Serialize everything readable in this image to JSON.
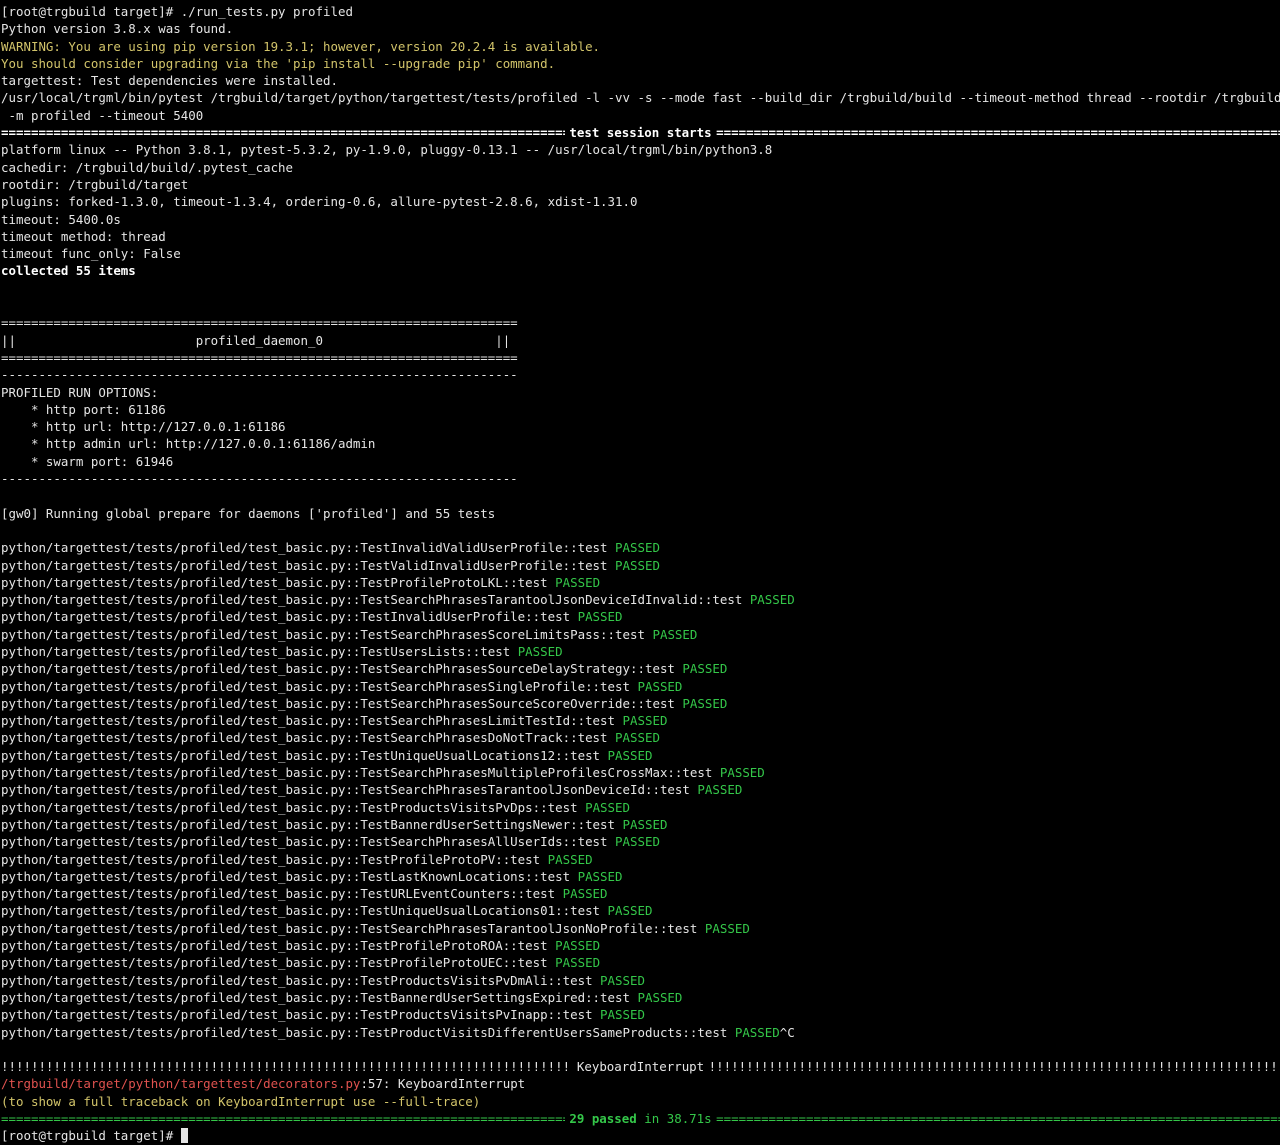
{
  "colors": {
    "background": "#000000",
    "text": "#e5e5e5",
    "warning": "#d2c46a",
    "passed": "#34c749",
    "error": "#e0524f"
  },
  "icons": {
    "cursor": "block-cursor-icon"
  },
  "header": {
    "command": "[root@trgbuild target]# ./run_tests.py profiled",
    "python_found": "Python version 3.8.x was found.",
    "warn1": "WARNING: You are using pip version 19.3.1; however, version 20.2.4 is available.",
    "warn2": "You should consider upgrading via the 'pip install --upgrade pip' command.",
    "deps": "targettest: Test dependencies were installed.",
    "pytest_cmd1": "/usr/local/trgml/bin/pytest /trgbuild/target/python/targettest/tests/profiled -l -vv -s --mode fast --build_dir /trgbuild/build --timeout-method thread --rootdir /trgbuild/target -",
    "pytest_cmd2": " -m profiled --timeout 5400"
  },
  "session": {
    "start_title": "test session starts",
    "platform": "platform linux -- Python 3.8.1, pytest-5.3.2, py-1.9.0, pluggy-0.13.1 -- /usr/local/trgml/bin/python3.8",
    "cachedir": "cachedir: /trgbuild/build/.pytest_cache",
    "rootdir": "rootdir: /trgbuild/target",
    "plugins": "plugins: forked-1.3.0, timeout-1.3.4, ordering-0.6, allure-pytest-2.8.6, xdist-1.31.0",
    "timeout": "timeout: 5400.0s",
    "timeout_method": "timeout method: thread",
    "timeout_func": "timeout func_only: False",
    "collected": "collected 55 items"
  },
  "daemon": {
    "eq_rule": "=====================================================================",
    "box_line": "||                        profiled_daemon_0                       ||",
    "dash_rule": "---------------------------------------------------------------------",
    "options_title": "PROFILED RUN OPTIONS:",
    "opt1": "    * http port: 61186",
    "opt2": "    * http url: http://127.0.0.1:61186",
    "opt3": "    * http admin url: http://127.0.0.1:61186/admin",
    "opt4": "    * swarm port: 61946",
    "prepare": "[gw0] Running global prepare for daemons ['profiled'] and 55 tests"
  },
  "tests": [
    {
      "name": "python/targettest/tests/profiled/test_basic.py::TestInvalidValidUserProfile::test ",
      "status": "PASSED"
    },
    {
      "name": "python/targettest/tests/profiled/test_basic.py::TestValidInvalidUserProfile::test ",
      "status": "PASSED"
    },
    {
      "name": "python/targettest/tests/profiled/test_basic.py::TestProfileProtoLKL::test ",
      "status": "PASSED"
    },
    {
      "name": "python/targettest/tests/profiled/test_basic.py::TestSearchPhrasesTarantoolJsonDeviceIdInvalid::test ",
      "status": "PASSED"
    },
    {
      "name": "python/targettest/tests/profiled/test_basic.py::TestInvalidUserProfile::test ",
      "status": "PASSED"
    },
    {
      "name": "python/targettest/tests/profiled/test_basic.py::TestSearchPhrasesScoreLimitsPass::test ",
      "status": "PASSED"
    },
    {
      "name": "python/targettest/tests/profiled/test_basic.py::TestUsersLists::test ",
      "status": "PASSED"
    },
    {
      "name": "python/targettest/tests/profiled/test_basic.py::TestSearchPhrasesSourceDelayStrategy::test ",
      "status": "PASSED"
    },
    {
      "name": "python/targettest/tests/profiled/test_basic.py::TestSearchPhrasesSingleProfile::test ",
      "status": "PASSED"
    },
    {
      "name": "python/targettest/tests/profiled/test_basic.py::TestSearchPhrasesSourceScoreOverride::test ",
      "status": "PASSED"
    },
    {
      "name": "python/targettest/tests/profiled/test_basic.py::TestSearchPhrasesLimitTestId::test ",
      "status": "PASSED"
    },
    {
      "name": "python/targettest/tests/profiled/test_basic.py::TestSearchPhrasesDoNotTrack::test ",
      "status": "PASSED"
    },
    {
      "name": "python/targettest/tests/profiled/test_basic.py::TestUniqueUsualLocations12::test ",
      "status": "PASSED"
    },
    {
      "name": "python/targettest/tests/profiled/test_basic.py::TestSearchPhrasesMultipleProfilesCrossMax::test ",
      "status": "PASSED"
    },
    {
      "name": "python/targettest/tests/profiled/test_basic.py::TestSearchPhrasesTarantoolJsonDeviceId::test ",
      "status": "PASSED"
    },
    {
      "name": "python/targettest/tests/profiled/test_basic.py::TestProductsVisitsPvDps::test ",
      "status": "PASSED"
    },
    {
      "name": "python/targettest/tests/profiled/test_basic.py::TestBannerdUserSettingsNewer::test ",
      "status": "PASSED"
    },
    {
      "name": "python/targettest/tests/profiled/test_basic.py::TestSearchPhrasesAllUserIds::test ",
      "status": "PASSED"
    },
    {
      "name": "python/targettest/tests/profiled/test_basic.py::TestProfileProtoPV::test ",
      "status": "PASSED"
    },
    {
      "name": "python/targettest/tests/profiled/test_basic.py::TestLastKnownLocations::test ",
      "status": "PASSED"
    },
    {
      "name": "python/targettest/tests/profiled/test_basic.py::TestURLEventCounters::test ",
      "status": "PASSED"
    },
    {
      "name": "python/targettest/tests/profiled/test_basic.py::TestUniqueUsualLocations01::test ",
      "status": "PASSED"
    },
    {
      "name": "python/targettest/tests/profiled/test_basic.py::TestSearchPhrasesTarantoolJsonNoProfile::test ",
      "status": "PASSED"
    },
    {
      "name": "python/targettest/tests/profiled/test_basic.py::TestProfileProtoROA::test ",
      "status": "PASSED"
    },
    {
      "name": "python/targettest/tests/profiled/test_basic.py::TestProfileProtoUEC::test ",
      "status": "PASSED"
    },
    {
      "name": "python/targettest/tests/profiled/test_basic.py::TestProductsVisitsPvDmAli::test ",
      "status": "PASSED"
    },
    {
      "name": "python/targettest/tests/profiled/test_basic.py::TestBannerdUserSettingsExpired::test ",
      "status": "PASSED"
    },
    {
      "name": "python/targettest/tests/profiled/test_basic.py::TestProductsVisitsPvInapp::test ",
      "status": "PASSED"
    },
    {
      "name": "python/targettest/tests/profiled/test_basic.py::TestProductVisitsDifferentUsersSameProducts::test ",
      "status": "PASSED",
      "suffix": "^C"
    }
  ],
  "footer": {
    "interrupt_title": "KeyboardInterrupt",
    "error_path": "/trgbuild/target/python/targettest/decorators.py",
    "error_rest": ":57: KeyboardInterrupt",
    "hint": "(to show a full traceback on KeyboardInterrupt use --full-trace)",
    "summary_passed": "29 passed",
    "summary_rest": " in 38.71s",
    "prompt": "[root@trgbuild target]# "
  }
}
